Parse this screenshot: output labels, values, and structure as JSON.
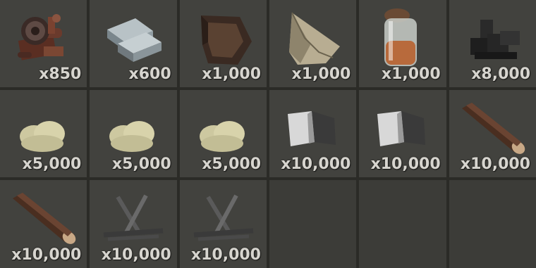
{
  "inventory": {
    "slots": [
      {
        "icon": "metal-fragments-icon",
        "quantity": "x850"
      },
      {
        "icon": "metal-bars-icon",
        "quantity": "x600"
      },
      {
        "icon": "leather-icon",
        "quantity": "x1,000"
      },
      {
        "icon": "cloth-icon",
        "quantity": "x1,000"
      },
      {
        "icon": "animal-fat-jar-icon",
        "quantity": "x1,000"
      },
      {
        "icon": "charcoal-icon",
        "quantity": "x8,000"
      },
      {
        "icon": "sulfur-icon",
        "quantity": "x5,000"
      },
      {
        "icon": "sulfur-icon",
        "quantity": "x5,000"
      },
      {
        "icon": "sulfur-icon",
        "quantity": "x5,000"
      },
      {
        "icon": "stones-icon",
        "quantity": "x10,000"
      },
      {
        "icon": "stones-icon",
        "quantity": "x10,000"
      },
      {
        "icon": "wood-log-icon",
        "quantity": "x10,000"
      },
      {
        "icon": "wood-log-icon",
        "quantity": "x10,000"
      },
      {
        "icon": "firewood-sticks-icon",
        "quantity": "x10,000"
      },
      {
        "icon": "firewood-sticks-icon",
        "quantity": "x10,000"
      },
      {
        "icon": "",
        "quantity": ""
      },
      {
        "icon": "",
        "quantity": ""
      },
      {
        "icon": "",
        "quantity": ""
      }
    ]
  }
}
